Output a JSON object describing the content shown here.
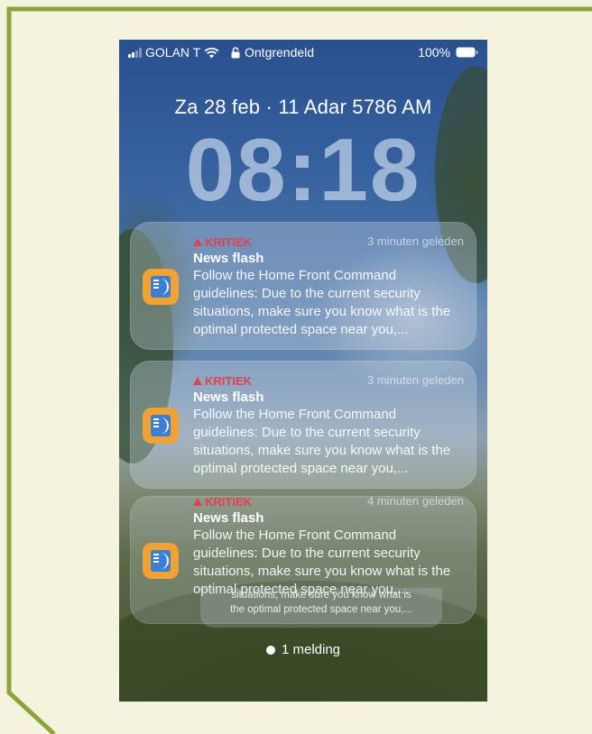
{
  "status_bar": {
    "carrier": "GOLAN T",
    "lock_status": "Ontgrendeld",
    "battery": "100%"
  },
  "lockscreen": {
    "date_line": "Za 28 feb · 11 Adar 5786 AM",
    "time": "08:18"
  },
  "notifications": [
    {
      "label": "KRITIEK",
      "time": "3 minuten geleden",
      "title": "News flash",
      "body": "Follow the Home Front Command guidelines: Due to the current security situations, make sure you know what is the optimal protected space near you,..."
    },
    {
      "label": "KRITIEK",
      "time": "3 minuten geleden",
      "title": "News flash",
      "body": "Follow the Home Front Command guidelines: Due to the current security situations, make sure you know what is the optimal protected space near you,..."
    },
    {
      "label": "KRITIEK",
      "time": "4 minuten geleden",
      "title": "News flash",
      "body": "Follow the Home Front Command guidelines: Due to the current security situations, make sure you know what is the optimal protected space near you,..."
    }
  ],
  "stack_tail": {
    "line1": "situations, make sure you know what is",
    "line2": "the optimal protected space near you,..."
  },
  "footer": {
    "count_label": "1 melding"
  },
  "colors": {
    "frame_accent": "#8aa53a",
    "background": "#f4f3de",
    "critical": "#e5404b",
    "app_icon": "#f1a233"
  }
}
